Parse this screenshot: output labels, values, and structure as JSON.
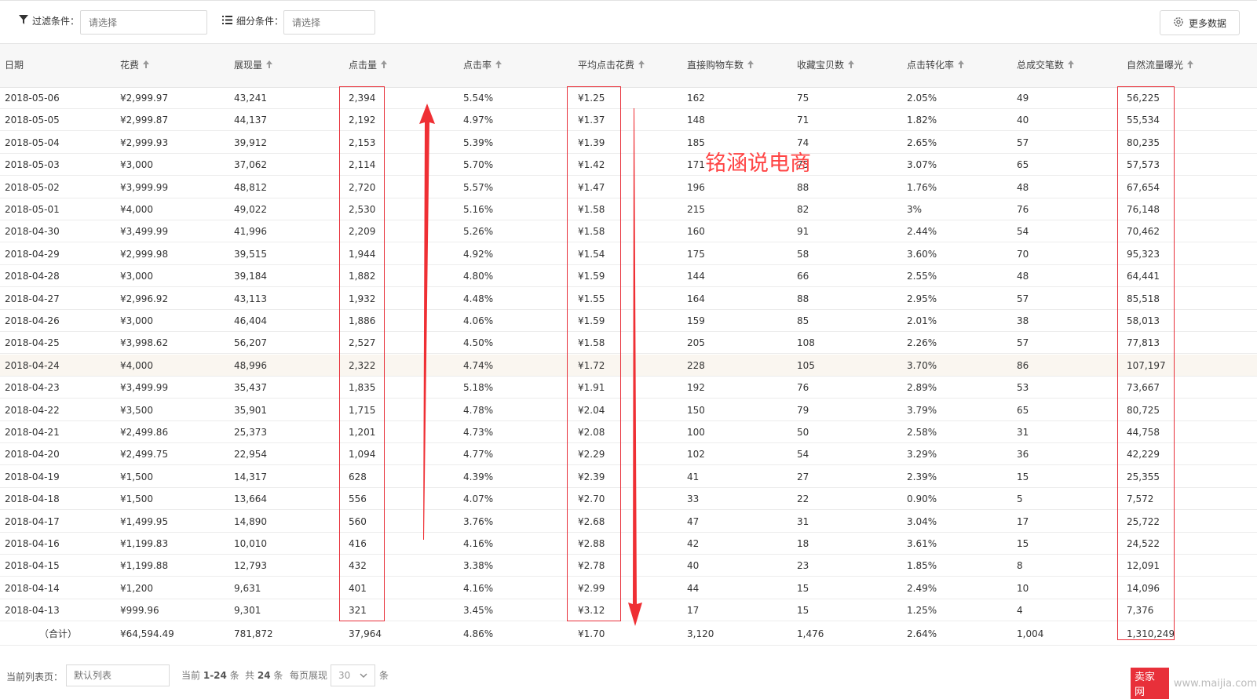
{
  "filters": {
    "filter_label": "过滤条件：",
    "filter_placeholder": "请选择",
    "segment_label": "细分条件：",
    "segment_placeholder": "请选择",
    "more_button": "更多数据"
  },
  "table": {
    "columns": [
      "日期",
      "花费",
      "展现量",
      "点击量",
      "点击率",
      "平均点击花费",
      "直接购物车数",
      "收藏宝贝数",
      "点击转化率",
      "总成交笔数",
      "自然流量曝光"
    ],
    "rows": [
      [
        "2018-05-06",
        "¥2,999.97",
        "43,241",
        "2,394",
        "5.54%",
        "¥1.25",
        "162",
        "75",
        "2.05%",
        "49",
        "56,225"
      ],
      [
        "2018-05-05",
        "¥2,999.87",
        "44,137",
        "2,192",
        "4.97%",
        "¥1.37",
        "148",
        "71",
        "1.82%",
        "40",
        "55,534"
      ],
      [
        "2018-05-04",
        "¥2,999.93",
        "39,912",
        "2,153",
        "5.39%",
        "¥1.39",
        "185",
        "74",
        "2.65%",
        "57",
        "80,235"
      ],
      [
        "2018-05-03",
        "¥3,000",
        "37,062",
        "2,114",
        "5.70%",
        "¥1.42",
        "171",
        "75",
        "3.07%",
        "65",
        "57,573"
      ],
      [
        "2018-05-02",
        "¥3,999.99",
        "48,812",
        "2,720",
        "5.57%",
        "¥1.47",
        "196",
        "88",
        "1.76%",
        "48",
        "67,654"
      ],
      [
        "2018-05-01",
        "¥4,000",
        "49,022",
        "2,530",
        "5.16%",
        "¥1.58",
        "215",
        "82",
        "3%",
        "76",
        "76,148"
      ],
      [
        "2018-04-30",
        "¥3,499.99",
        "41,996",
        "2,209",
        "5.26%",
        "¥1.58",
        "160",
        "91",
        "2.44%",
        "54",
        "70,462"
      ],
      [
        "2018-04-29",
        "¥2,999.98",
        "39,515",
        "1,944",
        "4.92%",
        "¥1.54",
        "175",
        "58",
        "3.60%",
        "70",
        "95,323"
      ],
      [
        "2018-04-28",
        "¥3,000",
        "39,184",
        "1,882",
        "4.80%",
        "¥1.59",
        "144",
        "66",
        "2.55%",
        "48",
        "64,441"
      ],
      [
        "2018-04-27",
        "¥2,996.92",
        "43,113",
        "1,932",
        "4.48%",
        "¥1.55",
        "164",
        "88",
        "2.95%",
        "57",
        "85,518"
      ],
      [
        "2018-04-26",
        "¥3,000",
        "46,404",
        "1,886",
        "4.06%",
        "¥1.59",
        "159",
        "85",
        "2.01%",
        "38",
        "58,013"
      ],
      [
        "2018-04-25",
        "¥3,998.62",
        "56,207",
        "2,527",
        "4.50%",
        "¥1.58",
        "205",
        "108",
        "2.26%",
        "57",
        "77,813"
      ],
      [
        "2018-04-24",
        "¥4,000",
        "48,996",
        "2,322",
        "4.74%",
        "¥1.72",
        "228",
        "105",
        "3.70%",
        "86",
        "107,197"
      ],
      [
        "2018-04-23",
        "¥3,499.99",
        "35,437",
        "1,835",
        "5.18%",
        "¥1.91",
        "192",
        "76",
        "2.89%",
        "53",
        "73,667"
      ],
      [
        "2018-04-22",
        "¥3,500",
        "35,901",
        "1,715",
        "4.78%",
        "¥2.04",
        "150",
        "79",
        "3.79%",
        "65",
        "80,725"
      ],
      [
        "2018-04-21",
        "¥2,499.86",
        "25,373",
        "1,201",
        "4.73%",
        "¥2.08",
        "100",
        "50",
        "2.58%",
        "31",
        "44,758"
      ],
      [
        "2018-04-20",
        "¥2,499.75",
        "22,954",
        "1,094",
        "4.77%",
        "¥2.29",
        "102",
        "54",
        "3.29%",
        "36",
        "42,229"
      ],
      [
        "2018-04-19",
        "¥1,500",
        "14,317",
        "628",
        "4.39%",
        "¥2.39",
        "41",
        "27",
        "2.39%",
        "15",
        "25,355"
      ],
      [
        "2018-04-18",
        "¥1,500",
        "13,664",
        "556",
        "4.07%",
        "¥2.70",
        "33",
        "22",
        "0.90%",
        "5",
        "7,572"
      ],
      [
        "2018-04-17",
        "¥1,499.95",
        "14,890",
        "560",
        "3.76%",
        "¥2.68",
        "47",
        "31",
        "3.04%",
        "17",
        "25,722"
      ],
      [
        "2018-04-16",
        "¥1,199.83",
        "10,010",
        "416",
        "4.16%",
        "¥2.88",
        "42",
        "18",
        "3.61%",
        "15",
        "24,522"
      ],
      [
        "2018-04-15",
        "¥1,199.88",
        "12,793",
        "432",
        "3.38%",
        "¥2.78",
        "40",
        "23",
        "1.85%",
        "8",
        "12,091"
      ],
      [
        "2018-04-14",
        "¥1,200",
        "9,631",
        "401",
        "4.16%",
        "¥2.99",
        "44",
        "15",
        "2.49%",
        "10",
        "14,096"
      ],
      [
        "2018-04-13",
        "¥999.96",
        "9,301",
        "321",
        "3.45%",
        "¥3.12",
        "17",
        "15",
        "1.25%",
        "4",
        "7,376"
      ]
    ],
    "total": [
      "（合计）",
      "¥64,594.49",
      "781,872",
      "37,964",
      "4.86%",
      "¥1.70",
      "3,120",
      "1,476",
      "2.64%",
      "1,004",
      "1,310,249"
    ],
    "highlighted_row": "2018-04-24",
    "sort_icon": "arrow-up-icon"
  },
  "annotation": {
    "watermark": "铭涵说电商",
    "color": "#e8303a"
  },
  "footer": {
    "current_list_label": "当前列表页：",
    "list_placeholder": "默认列表",
    "range_prefix": "当前",
    "range_value": "1-24",
    "range_suffix": "条",
    "total_prefix": "共",
    "total_value": "24",
    "total_suffix": "条",
    "per_page_label": "每页展现",
    "per_page_value": "30",
    "per_page_suffix": "条",
    "site_tag": "卖家网",
    "site_url": "www.maijia.com"
  }
}
